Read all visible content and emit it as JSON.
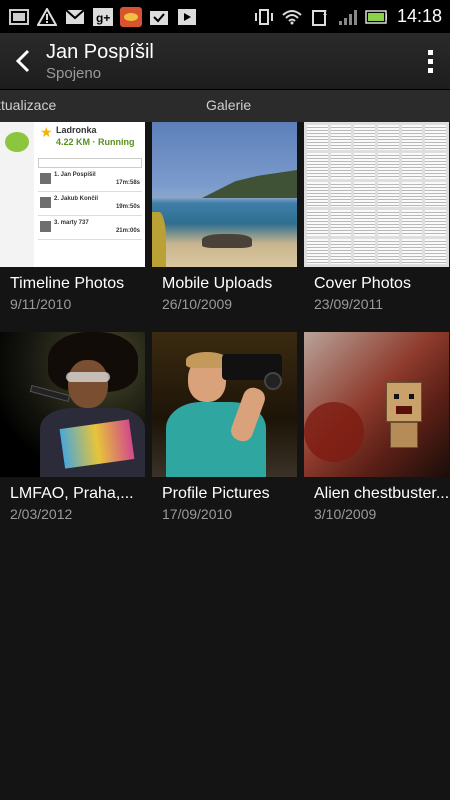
{
  "status_bar": {
    "time": "14:18",
    "left_icons": [
      "gallery-icon",
      "warning-icon",
      "gmail-icon",
      "google-plus-icon",
      "app-icon",
      "task-icon",
      "play-store-icon"
    ],
    "right_icons": [
      "vibrate-icon",
      "wifi-icon",
      "sim-icon",
      "signal-icon",
      "battery-icon"
    ],
    "battery_color": "#8bd14a"
  },
  "action_bar": {
    "title": "Jan Pospíšil",
    "subtitle": "Spojeno"
  },
  "tabs": {
    "left": "ktualizace",
    "center": "Galerie"
  },
  "albums": [
    {
      "title": "Timeline Photos",
      "date": "9/11/2010",
      "thumb_text": {
        "header": "Ladronka",
        "km": "4.22 KM · Running",
        "rows": [
          {
            "name": "1. Jan Pospíšil",
            "time": "17m:58s"
          },
          {
            "name": "2. Jakub Končil",
            "time": "19m:50s"
          },
          {
            "name": "3. marty 737",
            "time": "21m:00s"
          }
        ]
      }
    },
    {
      "title": "Mobile Uploads",
      "date": "26/10/2009"
    },
    {
      "title": "Cover Photos",
      "date": "23/09/2011"
    },
    {
      "title": "LMFAO, Praha,...",
      "date": "2/03/2012"
    },
    {
      "title": "Profile Pictures",
      "date": "17/09/2010"
    },
    {
      "title": "Alien chestbuster...",
      "date": "3/10/2009"
    }
  ]
}
